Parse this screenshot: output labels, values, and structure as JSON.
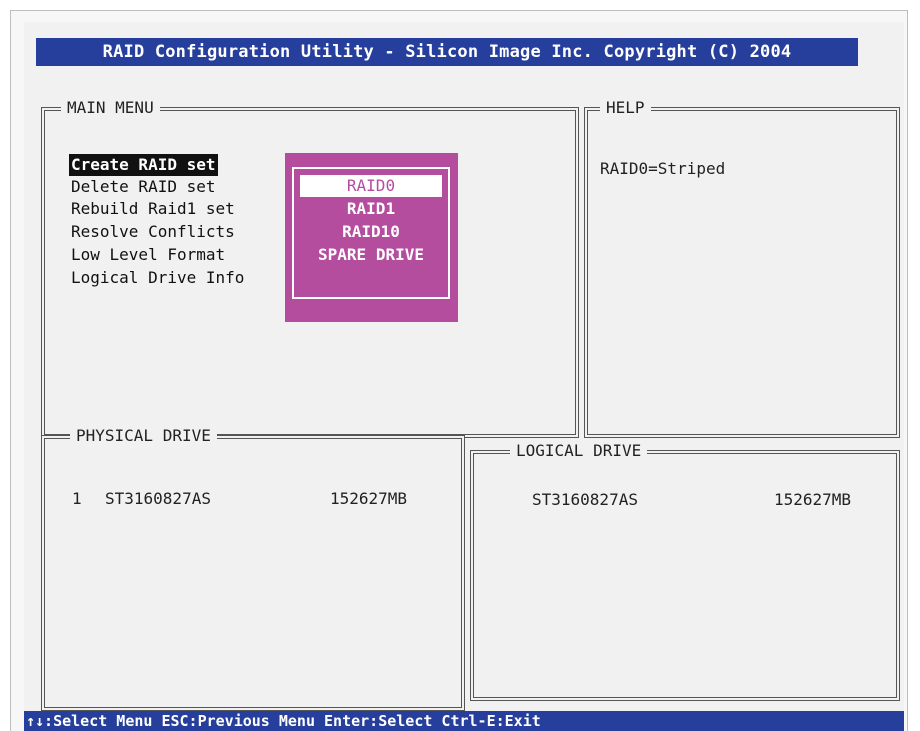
{
  "title_bar": {
    "text": "RAID Configuration Utility - Silicon Image Inc. Copyright (C) 2004"
  },
  "main_menu": {
    "title": "MAIN MENU",
    "items": [
      {
        "label": "Create RAID set",
        "selected": true
      },
      {
        "label": "Delete RAID set",
        "selected": false
      },
      {
        "label": "Rebuild Raid1 set",
        "selected": false
      },
      {
        "label": "Resolve Conflicts",
        "selected": false
      },
      {
        "label": "Low Level Format",
        "selected": false
      },
      {
        "label": "Logical Drive Info",
        "selected": false
      }
    ]
  },
  "raid_popup": {
    "options": [
      {
        "label": "RAID0",
        "selected": true
      },
      {
        "label": "RAID1",
        "selected": false
      },
      {
        "label": "RAID10",
        "selected": false
      },
      {
        "label": "SPARE DRIVE",
        "selected": false
      }
    ]
  },
  "help": {
    "title": "HELP",
    "text": "RAID0=Striped"
  },
  "physical_drive": {
    "title": "PHYSICAL DRIVE",
    "rows": [
      {
        "index": "1",
        "model": "ST3160827AS",
        "size": "152627MB"
      }
    ]
  },
  "logical_drive": {
    "title": "LOGICAL DRIVE",
    "rows": [
      {
        "model": "ST3160827AS",
        "size": "152627MB"
      }
    ]
  },
  "status_bar": {
    "text": "↑↓:Select Menu  ESC:Previous Menu  Enter:Select  Ctrl-E:Exit"
  },
  "colors": {
    "title_bar": "#263e9c",
    "popup": "#b54d9f",
    "screen_background": "#f1f1f1",
    "selection": "#111111"
  }
}
